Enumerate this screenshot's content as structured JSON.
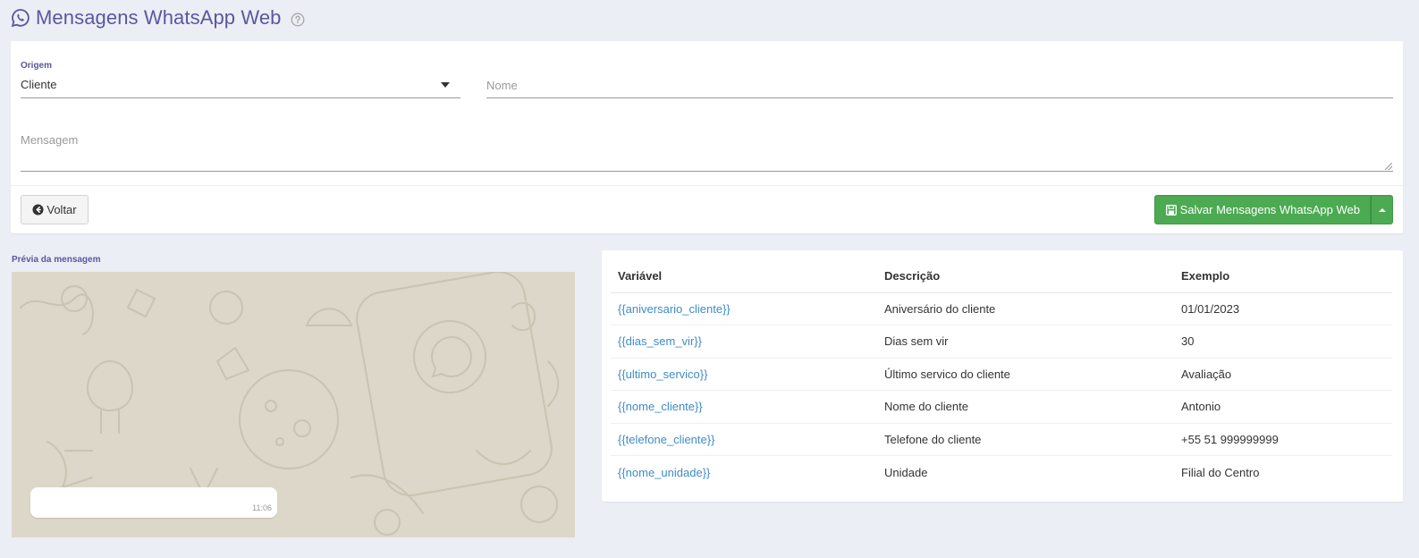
{
  "page": {
    "title": "Mensagens WhatsApp Web",
    "accent_color": "#5a57a0",
    "title_icon": "whatsapp-icon",
    "help_icon": "question-circle-icon"
  },
  "form": {
    "origem_label": "Origem",
    "origem_value": "Cliente",
    "nome_placeholder": "Nome",
    "nome_value": "",
    "mensagem_placeholder": "Mensagem",
    "mensagem_value": ""
  },
  "actions": {
    "back_label": "Voltar",
    "save_label": "Salvar Mensagens WhatsApp Web",
    "save_color": "#4caa52"
  },
  "preview": {
    "label": "Prévia da mensagem",
    "bubble_text": "",
    "time": "11:06"
  },
  "variables": {
    "headers": [
      "Variável",
      "Descrição",
      "Exemplo"
    ],
    "rows": [
      {
        "var": "{{aniversario_cliente}}",
        "desc": "Aniversário do cliente",
        "example": "01/01/2023"
      },
      {
        "var": "{{dias_sem_vir}}",
        "desc": "Dias sem vir",
        "example": "30"
      },
      {
        "var": "{{ultimo_servico}}",
        "desc": "Último servico do cliente",
        "example": "Avaliação"
      },
      {
        "var": "{{nome_cliente}}",
        "desc": "Nome do cliente",
        "example": "Antonio"
      },
      {
        "var": "{{telefone_cliente}}",
        "desc": "Telefone do cliente",
        "example": "+55 51 999999999"
      },
      {
        "var": "{{nome_unidade}}",
        "desc": "Unidade",
        "example": "Filial do Centro"
      }
    ]
  }
}
